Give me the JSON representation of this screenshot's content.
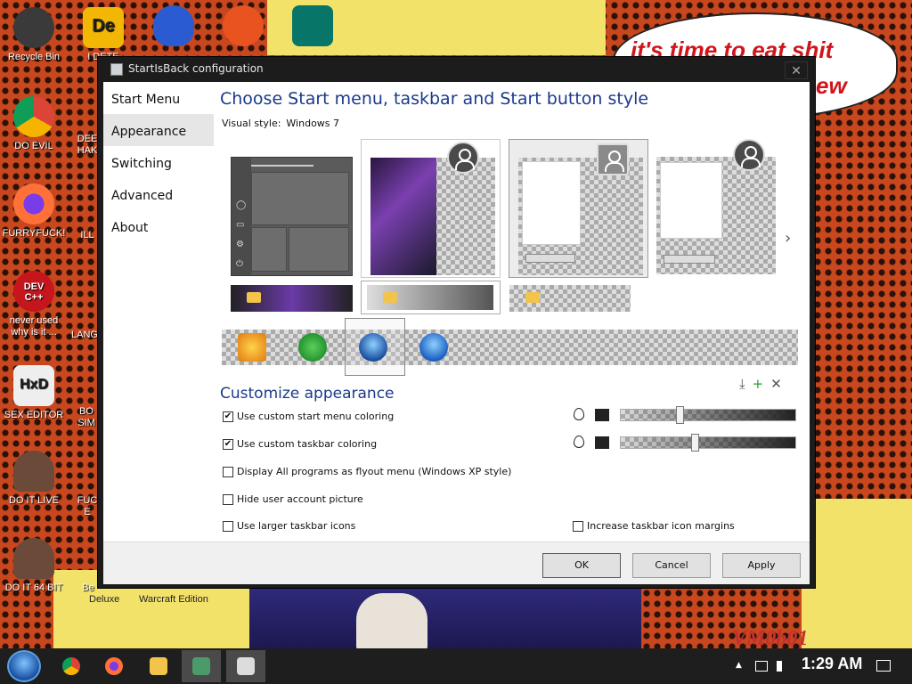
{
  "desktop": {
    "icons": [
      {
        "label": "Recycle Bin",
        "icon": "recycle-bin-icon",
        "color": "#3a3a3a"
      },
      {
        "label": "DO EVIL",
        "icon": "chrome-icon",
        "color": "#4285f4"
      },
      {
        "label": "FURRYFUCK!",
        "icon": "firefox-icon",
        "color": "#ff7139"
      },
      {
        "label": "never used why is it ...",
        "icon": "dev-cpp-icon",
        "color": "#c4161c",
        "glyph": "DEV C++"
      },
      {
        "label": "SEX EDITOR",
        "icon": "hxd-editor-icon",
        "color": "#e8e8e8",
        "glyph": "HxD"
      },
      {
        "label": "DO IT LIVE",
        "icon": "portrait-icon",
        "color": "#6b4a3a"
      },
      {
        "label": "DO IT 64 BIT",
        "icon": "portrait-64-icon",
        "color": "#6b4a3a"
      }
    ],
    "second_column": [
      {
        "label": "I DETE",
        "icon": "de-app-icon",
        "glyph": "De"
      },
      {
        "label": "DEE HAK",
        "icon": "app-icon"
      },
      {
        "label": "ILL",
        "icon": "app-icon"
      },
      {
        "label": "LANG",
        "icon": "app-icon"
      },
      {
        "label": "BO SIM",
        "icon": "app-icon"
      },
      {
        "label": "FUC E",
        "icon": "app-icon"
      },
      {
        "label": "Be",
        "icon": "app-icon"
      }
    ],
    "top_row_icons": [
      "question-shield-icon",
      "p-app-icon",
      "publisher-icon"
    ],
    "bubble_text": {
      "line1": "it's time to eat shit",
      "line2": "ew"
    },
    "watermark": "VM0b01",
    "labels": {
      "deluxe": "Deluxe",
      "warcraft": "Warcraft Edition"
    }
  },
  "window": {
    "title": "StartIsBack configuration",
    "close_label": "✕",
    "nav": [
      "Start Menu",
      "Appearance",
      "Switching",
      "Advanced",
      "About"
    ],
    "active_nav": 1,
    "heading": "Choose Start menu, taskbar and Start button style",
    "visual_style_label": "Visual style:",
    "visual_style_value": "Windows 7",
    "next_arrow": "›",
    "customize_heading": "Customize appearance",
    "tool_icons": {
      "download": "⤓",
      "add": "+",
      "remove": "✕"
    },
    "options": {
      "custom_start_menu_coloring": {
        "label": "Use custom start menu coloring",
        "checked": true
      },
      "custom_taskbar_coloring": {
        "label": "Use custom taskbar coloring",
        "checked": true
      },
      "all_programs_flyout": {
        "label": "Display All programs as flyout menu (Windows XP style)",
        "checked": false
      },
      "hide_user_picture": {
        "label": "Hide user account picture",
        "checked": false
      },
      "larger_taskbar_icons": {
        "label": "Use larger taskbar icons",
        "checked": false
      },
      "increase_icon_margins": {
        "label": "Increase taskbar icon margins",
        "checked": false
      }
    },
    "sliders": {
      "start_menu_opacity": 0.33,
      "taskbar_opacity": 0.42
    },
    "buttons": {
      "ok": "OK",
      "cancel": "Cancel",
      "apply": "Apply"
    },
    "check_mark": "✔"
  },
  "taskbar": {
    "pinned": [
      "chrome-icon",
      "firefox-icon",
      "file-explorer-icon",
      "startisback-config-icon",
      "window-app-icon"
    ],
    "tray_arrow": "▲",
    "clock": "1:29 AM"
  },
  "colors": {
    "heading_blue": "#1a3a8c",
    "window_frame": "#1c1c1c",
    "taskbar": "#1e1e1e"
  }
}
